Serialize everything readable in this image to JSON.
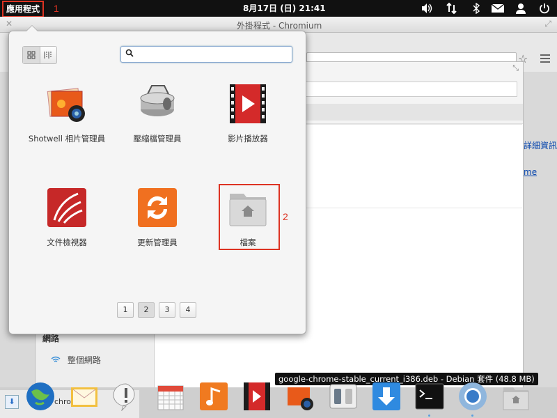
{
  "panel": {
    "apps_label": "應用程式",
    "clock": "8月17日 (日) 21:41",
    "annotation_1": "1"
  },
  "browser_window": {
    "title": "外掛程式 - Chromium",
    "side_link_1": "詳細資訊",
    "side_link_2": "me",
    "sidebar_network_heading": "網路",
    "sidebar_network_item": "整個網路"
  },
  "launcher": {
    "search": {
      "value": "",
      "placeholder": ""
    },
    "apps": [
      {
        "label": "Shotwell 相片管理員",
        "icon": "shotwell-icon"
      },
      {
        "label": "壓縮檔管理員",
        "icon": "archive-manager-icon"
      },
      {
        "label": "影片播放器",
        "icon": "video-player-icon"
      },
      {
        "label": "文件檢視器",
        "icon": "document-viewer-icon"
      },
      {
        "label": "更新管理員",
        "icon": "update-manager-icon"
      },
      {
        "label": "檔案",
        "icon": "files-icon"
      }
    ],
    "annotation_2": "2",
    "pages": [
      "1",
      "2",
      "3",
      "4"
    ],
    "current_page": "2"
  },
  "tooltip": "google-chrome-stable_current_i386.deb - Debian 套件 (48.8 MB)",
  "downloads_bar": {
    "text_partial": "chro"
  },
  "dock": [
    {
      "name": "web-browser-icon"
    },
    {
      "name": "mail-icon"
    },
    {
      "name": "notification-icon"
    },
    {
      "name": "calendar-icon"
    },
    {
      "name": "music-icon"
    },
    {
      "name": "video-player-icon"
    },
    {
      "name": "shotwell-icon"
    },
    {
      "name": "switchboard-icon"
    },
    {
      "name": "software-center-icon"
    },
    {
      "name": "terminal-icon"
    },
    {
      "name": "chromium-icon"
    },
    {
      "name": "files-icon"
    }
  ],
  "colors": {
    "accent_red": "#dd3322",
    "panel_bg": "#111111",
    "selection_blue": "#3a8fd8"
  }
}
